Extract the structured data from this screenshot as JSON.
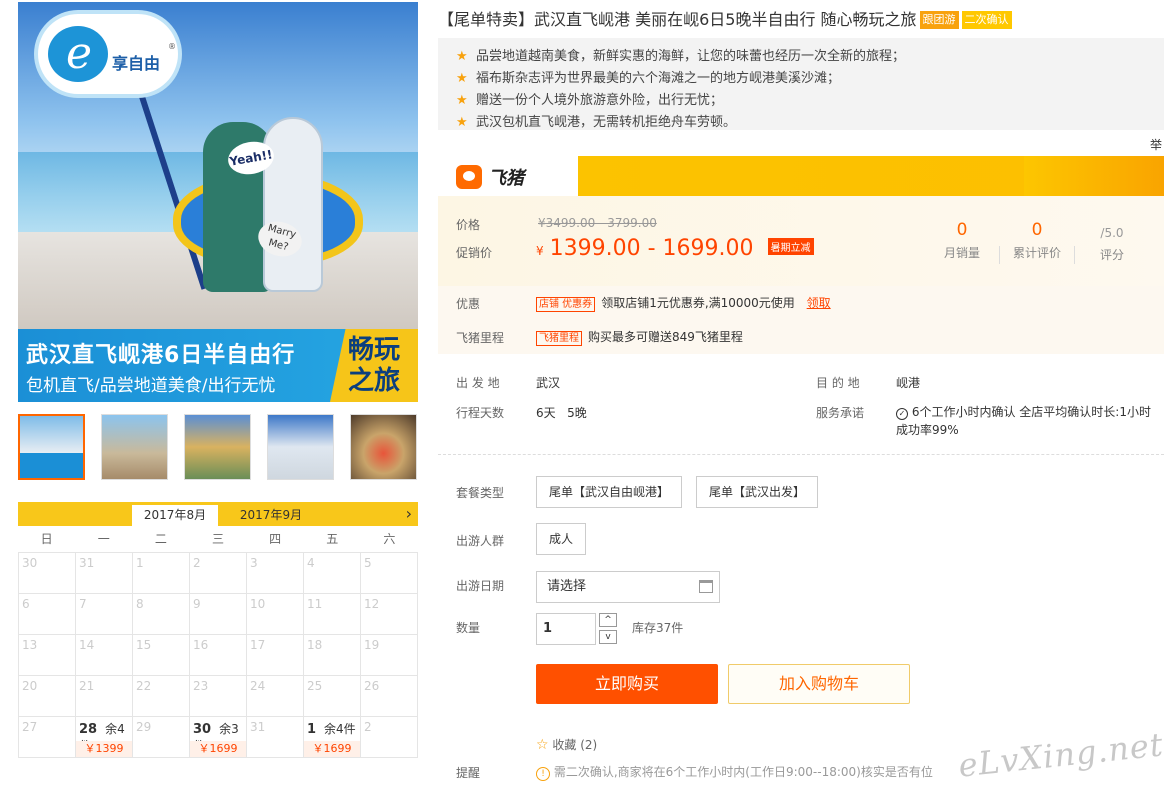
{
  "hero": {
    "logo_text": "享自由",
    "logo_reg": "®",
    "sign_text": "Yeah!!",
    "sign2_text": "Marry Me?",
    "banner_title": "武汉直飞岘港6日半自由行",
    "banner_sub": "包机直飞/品尝地道美食/出行无忧",
    "banner_badge": "畅玩之旅"
  },
  "thumbnails": [
    "thumb-1",
    "thumb-2",
    "thumb-3",
    "thumb-4",
    "thumb-5"
  ],
  "calendar": {
    "tab_active": "2017年8月",
    "tab_next": "2017年9月",
    "next_arrow": "›",
    "weekdays": [
      "日",
      "一",
      "二",
      "三",
      "四",
      "五",
      "六"
    ],
    "cells": [
      {
        "d": "30"
      },
      {
        "d": "31"
      },
      {
        "d": "1"
      },
      {
        "d": "2"
      },
      {
        "d": "3"
      },
      {
        "d": "4"
      },
      {
        "d": "5"
      },
      {
        "d": "6"
      },
      {
        "d": "7"
      },
      {
        "d": "8"
      },
      {
        "d": "9"
      },
      {
        "d": "10"
      },
      {
        "d": "11"
      },
      {
        "d": "12"
      },
      {
        "d": "13"
      },
      {
        "d": "14"
      },
      {
        "d": "15"
      },
      {
        "d": "16"
      },
      {
        "d": "17"
      },
      {
        "d": "18"
      },
      {
        "d": "19"
      },
      {
        "d": "20"
      },
      {
        "d": "21"
      },
      {
        "d": "22"
      },
      {
        "d": "23"
      },
      {
        "d": "24"
      },
      {
        "d": "25"
      },
      {
        "d": "26"
      },
      {
        "d": "27"
      },
      {
        "d": "28",
        "stock": "余4件",
        "price": "￥1399"
      },
      {
        "d": "29"
      },
      {
        "d": "30",
        "stock": "余3件",
        "price": "￥1699"
      },
      {
        "d": "31"
      },
      {
        "d": "1",
        "stock": "余4件",
        "price": "￥1699"
      },
      {
        "d": "2"
      }
    ]
  },
  "product": {
    "title": "【尾单特卖】武汉直飞岘港 美丽在岘6日5晚半自由行 随心畅玩之旅",
    "tag1": "跟团游",
    "tag2": "二次确认",
    "features": [
      "品尝地道越南美食，新鲜实惠的海鲜，让您的味蕾也经历一次全新的旅程；",
      "福布斯杂志评为世界最美的六个海滩之一的地方岘港美溪沙滩；",
      "赠送一份个人境外旅游意外险，出行无忧；",
      "武汉包机直飞岘港，无需转机拒绝舟车劳顿。"
    ],
    "side_char": "举"
  },
  "fliggy": {
    "name": "飞猪"
  },
  "price": {
    "price_label": "价格",
    "orig": "¥3499.00 - 3799.00",
    "promo_label": "促销价",
    "currency": "¥",
    "promo": "1399.00 - 1699.00",
    "sale_tag": "暑期立减",
    "stats": [
      {
        "num": "0",
        "label": "月销量"
      },
      {
        "num": "0",
        "label": "累计评价"
      },
      {
        "num": "/5.0",
        "label": "评分"
      }
    ]
  },
  "coupon": {
    "label": "优惠",
    "tag": "店铺 优惠券",
    "text": "领取店铺1元优惠券,满10000元使用",
    "link": "领取",
    "miles_label": "飞猪里程",
    "miles_tag": "飞猪里程",
    "miles_text": "购买最多可赠送849飞猪里程"
  },
  "info": {
    "depart_label": "出 发 地",
    "depart": "武汉",
    "dest_label": "目 的 地",
    "dest": "岘港",
    "days_label": "行程天数",
    "days": "6天",
    "nights": "5晚",
    "service_label": "服务承诺",
    "service_line1": "6个工作小时内确认 全店平均确认时长:1小时",
    "service_line2": "成功率99%"
  },
  "options": {
    "package_label": "套餐类型",
    "package1": "尾单【武汉自由岘港】",
    "package2": "尾单【武汉出发】",
    "crowd_label": "出游人群",
    "crowd": "成人",
    "date_label": "出游日期",
    "date_placeholder": "请选择",
    "qty_label": "数量",
    "qty": "1",
    "spin_up": "^",
    "spin_down": "v",
    "stock": "库存37件",
    "buy": "立即购买",
    "cart": "加入购物车",
    "favorite": "收藏",
    "favorite_count": "(2)",
    "remind_label": "提醒",
    "remind_text": "需二次确认,商家将在6个工作小时内(工作日9:00--18:00)核实是否有位"
  },
  "watermark": "eLvXing.net"
}
